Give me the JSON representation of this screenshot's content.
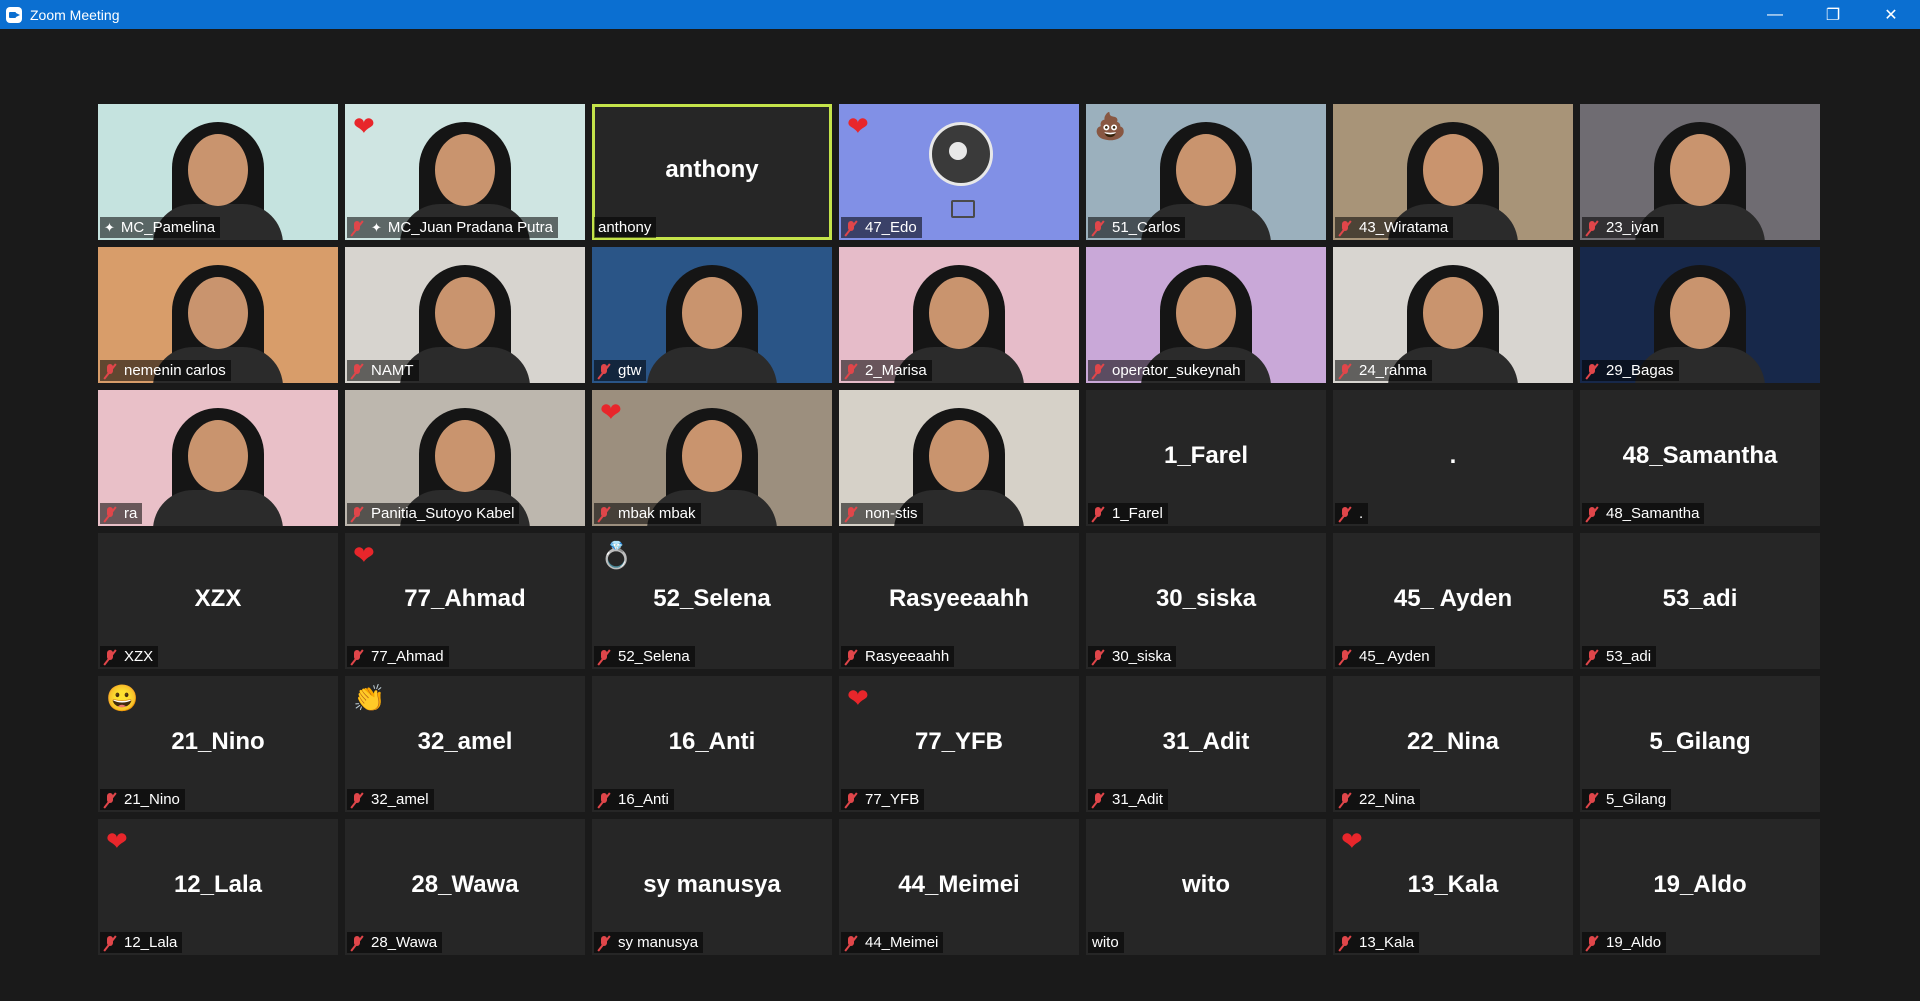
{
  "window": {
    "title": "Zoom Meeting",
    "controls": {
      "minimize": "—",
      "restore": "❐",
      "close": "✕"
    }
  },
  "participants": [
    {
      "name": "MC_Pamelina",
      "video": true,
      "bg": "#c5e3df",
      "mic_muted": false,
      "pin": true
    },
    {
      "name": "MC_Juan Pradana Putra",
      "video": true,
      "bg": "#cfe5e2",
      "mic_muted": true,
      "pin": true,
      "reaction": "❤"
    },
    {
      "name": "anthony",
      "display_name": "anthony",
      "video": false,
      "active_speaker": true,
      "mic_muted": false
    },
    {
      "name": "47_Edo",
      "video": true,
      "bg": "#8190e6",
      "mic_muted": true,
      "reaction": "❤",
      "obs": true
    },
    {
      "name": "51_Carlos",
      "video": true,
      "bg": "#9bb0bd",
      "mic_muted": true,
      "reaction": "💩"
    },
    {
      "name": "43_Wiratama",
      "video": true,
      "bg": "#a89478",
      "mic_muted": true
    },
    {
      "name": "23_iyan",
      "video": true,
      "bg": "#6f6c72",
      "mic_muted": true
    },
    {
      "name": "nemenin carlos",
      "video": true,
      "bg": "#d89d6a",
      "mic_muted": true
    },
    {
      "name": "NAMT",
      "video": true,
      "bg": "#d7d4cf",
      "mic_muted": true
    },
    {
      "name": "gtw",
      "video": true,
      "bg": "#2a5587",
      "mic_muted": true
    },
    {
      "name": "2_Marisa",
      "video": true,
      "bg": "#e6bcc9",
      "mic_muted": true
    },
    {
      "name": "operator_sukeynah",
      "video": true,
      "bg": "#c9a8d8",
      "mic_muted": true
    },
    {
      "name": "24_rahma",
      "video": true,
      "bg": "#d8d5d0",
      "mic_muted": true
    },
    {
      "name": "29_Bagas",
      "video": true,
      "bg": "#17284a",
      "mic_muted": true
    },
    {
      "name": "ra",
      "video": true,
      "bg": "#e9c0c8",
      "mic_muted": true
    },
    {
      "name": "Panitia_Sutoyo Kabel",
      "video": true,
      "bg": "#bdb7ae",
      "mic_muted": true
    },
    {
      "name": "mbak mbak",
      "video": true,
      "bg": "#9c8f7e",
      "mic_muted": true,
      "reaction": "❤"
    },
    {
      "name": "non-stis",
      "video": true,
      "bg": "#d6d1c8",
      "mic_muted": true
    },
    {
      "name": "1_Farel",
      "display_name": "1_Farel",
      "video": false,
      "mic_muted": true
    },
    {
      "name": ".",
      "display_name": ".",
      "video": false,
      "mic_muted": true
    },
    {
      "name": "48_Samantha",
      "display_name": "48_Samantha",
      "video": false,
      "mic_muted": true
    },
    {
      "name": "XZX",
      "display_name": "XZX",
      "video": false,
      "mic_muted": true
    },
    {
      "name": "77_Ahmad",
      "display_name": "77_Ahmad",
      "video": false,
      "mic_muted": true,
      "reaction": "❤"
    },
    {
      "name": "52_Selena",
      "display_name": "52_Selena",
      "video": false,
      "mic_muted": true,
      "reaction": "💍"
    },
    {
      "name": "Rasyeeaahh",
      "display_name": "Rasyeeaahh",
      "video": false,
      "mic_muted": true
    },
    {
      "name": "30_siska",
      "display_name": "30_siska",
      "video": false,
      "mic_muted": true
    },
    {
      "name": "45_ Ayden",
      "display_name": "45_ Ayden",
      "video": false,
      "mic_muted": true
    },
    {
      "name": "53_adi",
      "display_name": "53_adi",
      "video": false,
      "mic_muted": true
    },
    {
      "name": "21_Nino",
      "display_name": "21_Nino",
      "video": false,
      "mic_muted": true,
      "reaction": "😀"
    },
    {
      "name": "32_amel",
      "display_name": "32_amel",
      "video": false,
      "mic_muted": true,
      "reaction": "👏"
    },
    {
      "name": "16_Anti",
      "display_name": "16_Anti",
      "video": false,
      "mic_muted": true
    },
    {
      "name": "77_YFB",
      "display_name": "77_YFB",
      "video": false,
      "mic_muted": true,
      "reaction": "❤"
    },
    {
      "name": "31_Adit",
      "display_name": "31_Adit",
      "video": false,
      "mic_muted": true
    },
    {
      "name": "22_Nina",
      "display_name": "22_Nina",
      "video": false,
      "mic_muted": true
    },
    {
      "name": "5_Gilang",
      "display_name": "5_Gilang",
      "video": false,
      "mic_muted": true
    },
    {
      "name": "12_Lala",
      "display_name": "12_Lala",
      "video": false,
      "mic_muted": true,
      "reaction": "❤"
    },
    {
      "name": "28_Wawa",
      "display_name": "28_Wawa",
      "video": false,
      "mic_muted": true
    },
    {
      "name": "sy manusya",
      "display_name": "sy manusya",
      "video": false,
      "mic_muted": true
    },
    {
      "name": "44_Meimei",
      "display_name": "44_Meimei",
      "video": false,
      "mic_muted": true
    },
    {
      "name": "wito",
      "display_name": "wito",
      "video": false,
      "mic_muted": false
    },
    {
      "name": "13_Kala",
      "display_name": "13_Kala",
      "video": false,
      "mic_muted": true,
      "reaction": "❤"
    },
    {
      "name": "19_Aldo",
      "display_name": "19_Aldo",
      "video": false,
      "mic_muted": true
    }
  ]
}
